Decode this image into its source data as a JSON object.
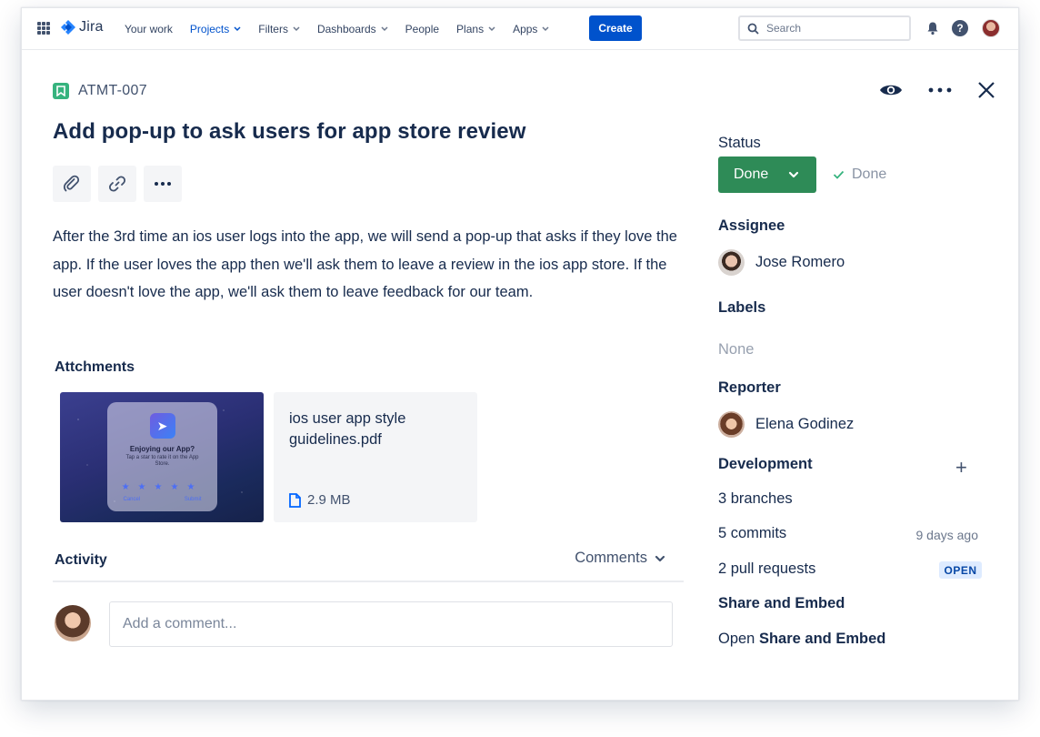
{
  "nav": {
    "logo": "Jira",
    "items": [
      {
        "label": "Your work",
        "dropdown": false,
        "active": false
      },
      {
        "label": "Projects",
        "dropdown": true,
        "active": true
      },
      {
        "label": "Filters",
        "dropdown": true,
        "active": false
      },
      {
        "label": "Dashboards",
        "dropdown": true,
        "active": false
      },
      {
        "label": "People",
        "dropdown": false,
        "active": false
      },
      {
        "label": "Plans",
        "dropdown": true,
        "active": false
      },
      {
        "label": "Apps",
        "dropdown": true,
        "active": false
      }
    ],
    "create_label": "Create",
    "search_placeholder": "Search"
  },
  "issue": {
    "key": "ATMT-007",
    "title": "Add pop-up to ask users for app store review",
    "description": "After the 3rd time an ios user logs into the app, we will send a pop-up that asks if they love the app. If the user loves the app then we'll ask them to leave a review in the ios app store. If the user doesn't love the app, we'll ask them to leave feedback for our team."
  },
  "attachments": {
    "title": "Attchments",
    "image": {
      "dialog_title": "Enjoying our App?",
      "dialog_sub": "Tap a star to rate it on the App Store.",
      "cancel": "Cancel",
      "submit": "Submit"
    },
    "file": {
      "name": "ios user app style guidelines.pdf",
      "size": "2.9 MB"
    }
  },
  "activity": {
    "title": "Activity",
    "filter": "Comments",
    "comment_placeholder": "Add a comment..."
  },
  "sidebar": {
    "status_label": "Status",
    "status_value": "Done",
    "status_resolution": "Done",
    "assignee_label": "Assignee",
    "assignee": "Jose Romero",
    "labels_label": "Labels",
    "labels_value": "None",
    "reporter_label": "Reporter",
    "reporter": "Elena Godinez",
    "development_label": "Development",
    "branches": "3 branches",
    "commits": "5 commits",
    "commits_time": "9 days ago",
    "pull_requests": "2 pull requests",
    "pr_status": "OPEN",
    "share_label": "Share and Embed",
    "share_open_prefix": "Open",
    "share_open_strong": "Share and Embed"
  },
  "colors": {
    "primary": "#0052cc",
    "done_green": "#2e8b57",
    "story_green": "#36b37e",
    "open_badge_bg": "#deebff"
  }
}
